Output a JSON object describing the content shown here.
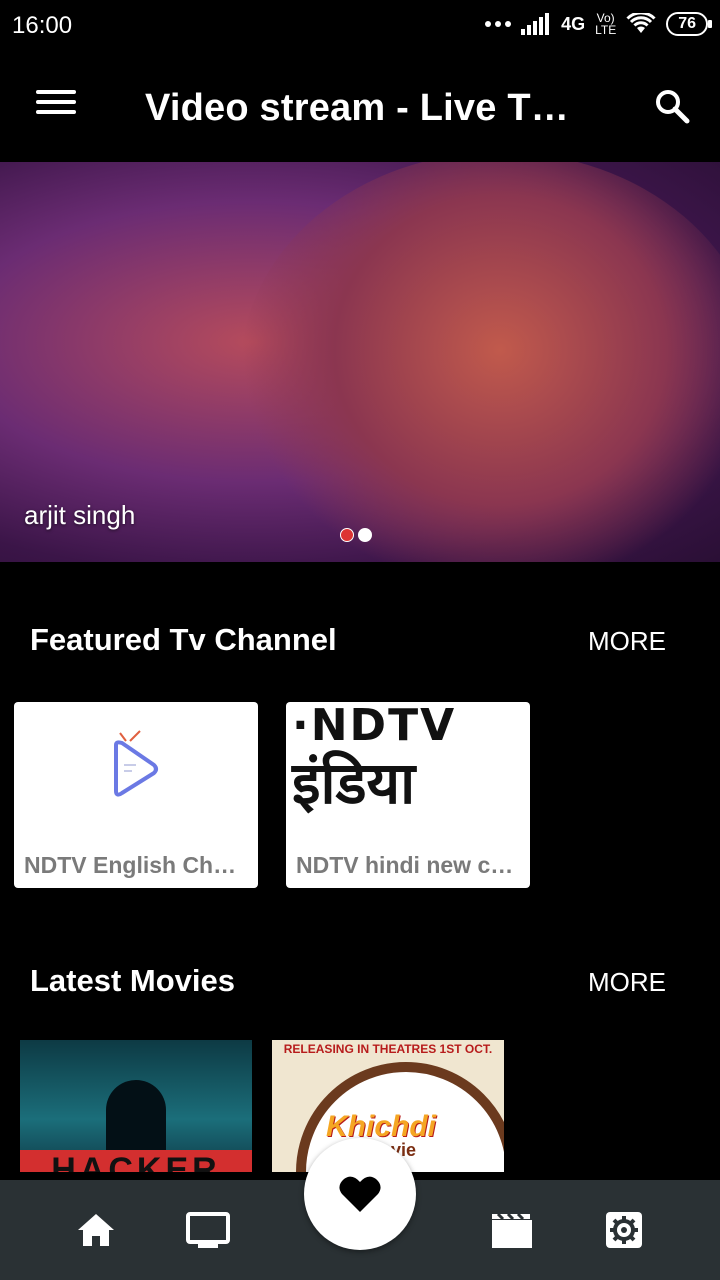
{
  "status_bar": {
    "time": "16:00",
    "network": "4G",
    "volte_top": "Vo)",
    "volte_bottom": "LTE",
    "battery": "76"
  },
  "app_bar": {
    "title": "Video stream - Live TV..."
  },
  "hero": {
    "caption": "arjit singh",
    "active_index": 1,
    "total": 2
  },
  "featured": {
    "title": "Featured Tv Channel",
    "more": "MORE",
    "channels": [
      {
        "name": "NDTV English Cha...",
        "logo": "tv-play-icon"
      },
      {
        "name": "NDTV hindi new ch...",
        "logo_top": "·NDTV",
        "logo_bottom": "इंडिया"
      }
    ]
  },
  "movies": {
    "title": "Latest Movies",
    "more": "MORE",
    "items": [
      {
        "poster_text": "HACKER"
      },
      {
        "banner": "RELEASING IN THEATRES 1ST OCT.",
        "title": "Khichdi",
        "subtitle": "movie"
      }
    ]
  },
  "bottom_nav": {
    "icons": [
      "home-icon",
      "tv-icon",
      "favorite-icon",
      "movie-icon",
      "settings-icon"
    ]
  },
  "colors": {
    "accent_red": "#D32F2F",
    "bottom_nav_bg": "#2A3134",
    "tv_icon_blue": "#6B79E4"
  }
}
